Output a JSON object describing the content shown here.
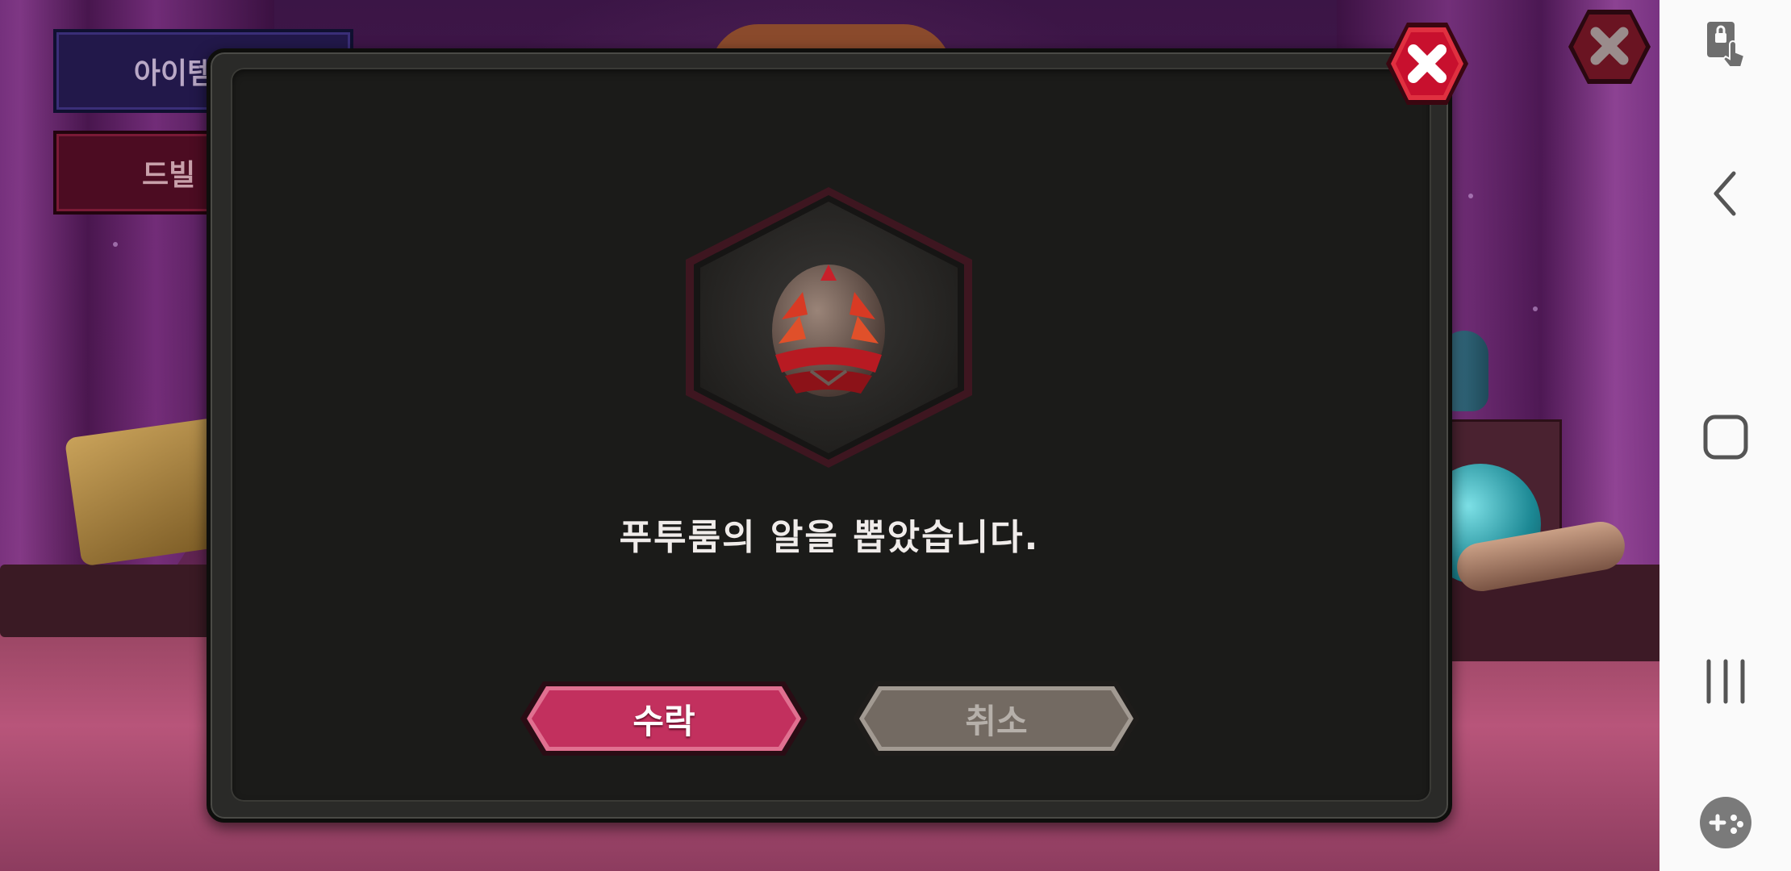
{
  "background": {
    "item_code_button": "아이템코",
    "drill_button": "드빌 가"
  },
  "dialog": {
    "message": "푸투룸의 알을 뽑았습니다.",
    "item_icon": "egg-icon",
    "accept_label": "수락",
    "cancel_label": "취소",
    "close_icon": "close-icon"
  },
  "navbar": {
    "items": [
      "screen-lock-touch-icon",
      "back-icon",
      "home-icon",
      "recent-apps-icon",
      "game-tools-icon"
    ]
  },
  "colors": {
    "accept": "#c2305e",
    "cancel": "#7a7068",
    "dialog_bg": "#1b1b19",
    "close_red": "#c8102e"
  }
}
